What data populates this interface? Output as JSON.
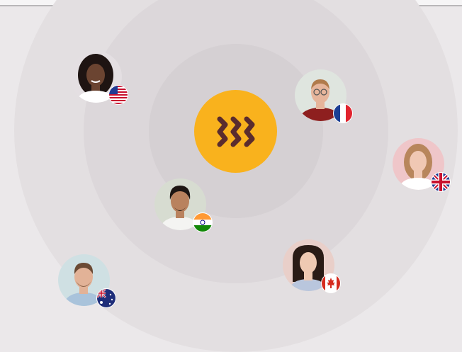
{
  "logo": {
    "icon": "brand-logo-icon",
    "color": "#f9b21d",
    "glyph_color": "#5a2c2e"
  },
  "avatars": [
    {
      "id": "usa",
      "flag_icon": "flag-usa-icon",
      "bg": "#e4dfe2",
      "skin": "#6b4431",
      "hair": "#1e1412",
      "shirt": "#ffffff"
    },
    {
      "id": "france",
      "flag_icon": "flag-france-icon",
      "bg": "#dfe5df",
      "skin": "#e6b59b",
      "hair": "#b07b4c",
      "shirt": "#8e1f1f"
    },
    {
      "id": "uk",
      "flag_icon": "flag-uk-icon",
      "bg": "#efc6c9",
      "skin": "#f0c8b4",
      "hair": "#b8865c",
      "shirt": "#ffffff"
    },
    {
      "id": "india",
      "flag_icon": "flag-india-icon",
      "bg": "#d7dcd1",
      "skin": "#b9825e",
      "hair": "#1d1613",
      "shirt": "#f4f4f2"
    },
    {
      "id": "canada",
      "flag_icon": "flag-canada-icon",
      "bg": "#e9cfc9",
      "skin": "#efc9b2",
      "hair": "#2a1b15",
      "shirt": "#b9c6dd"
    },
    {
      "id": "australia",
      "flag_icon": "flag-australia-icon",
      "bg": "#cfe0e3",
      "skin": "#e2b297",
      "hair": "#6b4a34",
      "shirt": "#a9c3db"
    }
  ]
}
